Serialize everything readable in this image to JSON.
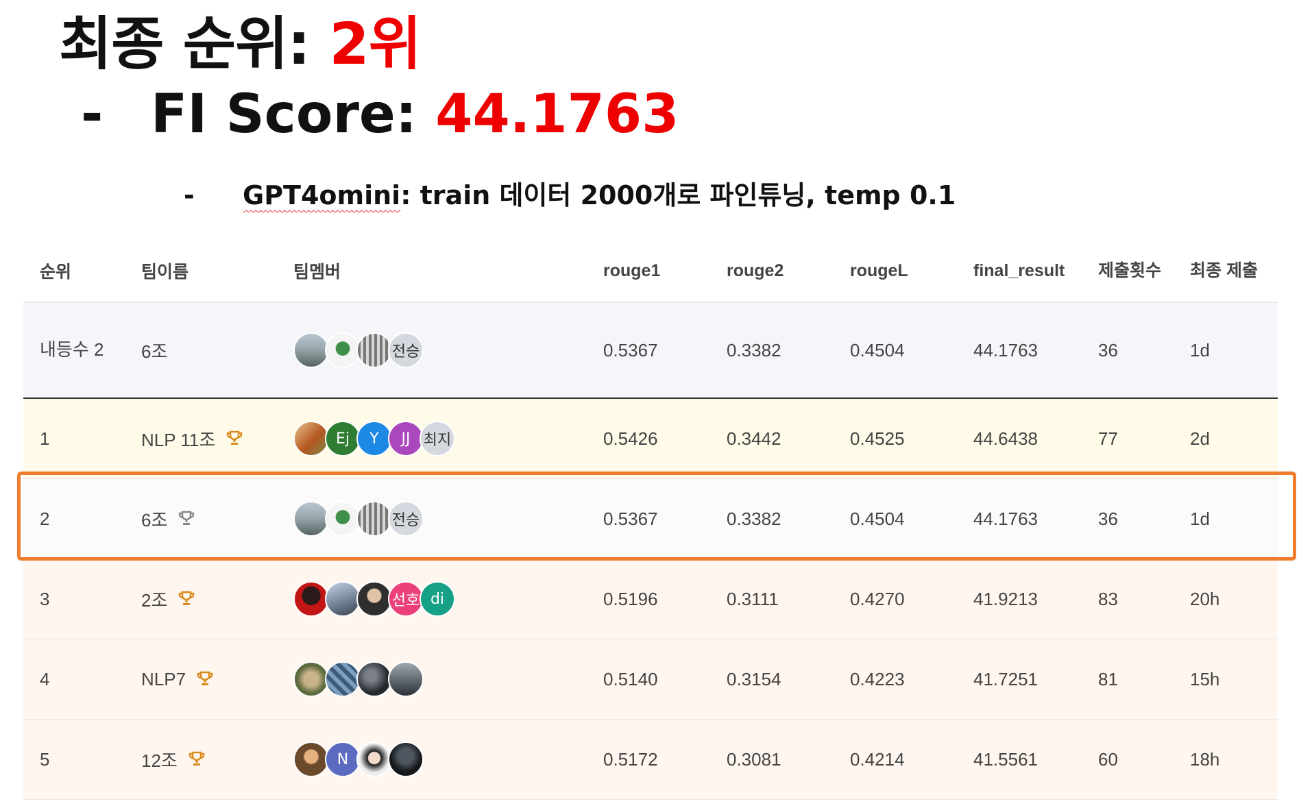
{
  "headline": {
    "rank_label": "최종 순위: ",
    "rank_value": "2위",
    "score_dash": "-",
    "score_label": "FI Score: ",
    "score_value": "44.1763",
    "note_dash": "-",
    "note_model": "GPT4omini",
    "note_text": ": train 데이터 2000개로 파인튜닝, temp 0.1"
  },
  "colors": {
    "highlight": "#ee0000",
    "box_border": "#ee7d2e",
    "trophy_gold": "#d98a1c",
    "first_row_bg": "#fffbe8"
  },
  "table": {
    "headers": {
      "rank": "순위",
      "team": "팀이름",
      "members": "팀멤버",
      "rouge1": "rouge1",
      "rouge2": "rouge2",
      "rougeL": "rougeL",
      "final_result": "final_result",
      "submissions": "제출횟수",
      "last_submit": "최종 제출"
    },
    "own_row": {
      "rank": "내등수 2",
      "team": "6조",
      "members": [
        {
          "kind": "photo",
          "icon": "landscape-avatar"
        },
        {
          "kind": "photo",
          "icon": "figure-avatar"
        },
        {
          "kind": "photo",
          "icon": "qr-avatar"
        },
        {
          "kind": "text",
          "label": "전승"
        }
      ],
      "rouge1": "0.5367",
      "rouge2": "0.3382",
      "rougeL": "0.4504",
      "final_result": "44.1763",
      "submissions": "36",
      "last_submit": "1d"
    },
    "rows": [
      {
        "rank": "1",
        "team": "NLP 11조",
        "trophy": "gold",
        "members": [
          {
            "kind": "photo",
            "icon": "dog-avatar"
          },
          {
            "kind": "text",
            "label": "Ej",
            "color": "#2e7d32"
          },
          {
            "kind": "text",
            "label": "Y",
            "color": "#1e88e5"
          },
          {
            "kind": "text",
            "label": "JJ",
            "color": "#ab47bc"
          },
          {
            "kind": "text",
            "label": "최지",
            "color": "#d5d8de"
          }
        ],
        "rouge1": "0.5426",
        "rouge2": "0.3442",
        "rougeL": "0.4525",
        "final_result": "44.6438",
        "submissions": "77",
        "last_submit": "2d"
      },
      {
        "rank": "2",
        "team": "6조",
        "trophy": "grey",
        "members": [
          {
            "kind": "photo",
            "icon": "landscape-avatar"
          },
          {
            "kind": "photo",
            "icon": "figure-avatar"
          },
          {
            "kind": "photo",
            "icon": "qr-avatar"
          },
          {
            "kind": "text",
            "label": "전승",
            "color": "#d5d8de"
          }
        ],
        "rouge1": "0.5367",
        "rouge2": "0.3382",
        "rougeL": "0.4504",
        "final_result": "44.1763",
        "submissions": "36",
        "last_submit": "1d"
      },
      {
        "rank": "3",
        "team": "2조",
        "trophy": "gold",
        "members": [
          {
            "kind": "photo",
            "icon": "red-portrait-avatar"
          },
          {
            "kind": "photo",
            "icon": "outdoor-avatar"
          },
          {
            "kind": "photo",
            "icon": "person-avatar"
          },
          {
            "kind": "text",
            "label": "선호",
            "color": "#ec407a"
          },
          {
            "kind": "text",
            "label": "di",
            "color": "#16a085"
          }
        ],
        "rouge1": "0.5196",
        "rouge2": "0.3111",
        "rougeL": "0.4270",
        "final_result": "41.9213",
        "submissions": "83",
        "last_submit": "20h"
      },
      {
        "rank": "4",
        "team": "NLP7",
        "trophy": "gold",
        "members": [
          {
            "kind": "photo",
            "icon": "cat-avatar"
          },
          {
            "kind": "photo",
            "icon": "pattern-avatar"
          },
          {
            "kind": "photo",
            "icon": "dark-avatar"
          },
          {
            "kind": "photo",
            "icon": "street-avatar"
          }
        ],
        "rouge1": "0.5140",
        "rouge2": "0.3154",
        "rougeL": "0.4223",
        "final_result": "41.7251",
        "submissions": "81",
        "last_submit": "15h"
      },
      {
        "rank": "5",
        "team": "12조",
        "trophy": "gold",
        "members": [
          {
            "kind": "photo",
            "icon": "character-avatar"
          },
          {
            "kind": "text",
            "label": "N",
            "color": "#5c6bc0"
          },
          {
            "kind": "photo",
            "icon": "girl-avatar"
          },
          {
            "kind": "photo",
            "icon": "night-avatar"
          }
        ],
        "rouge1": "0.5172",
        "rouge2": "0.3081",
        "rougeL": "0.4214",
        "final_result": "41.5561",
        "submissions": "60",
        "last_submit": "18h"
      }
    ]
  }
}
